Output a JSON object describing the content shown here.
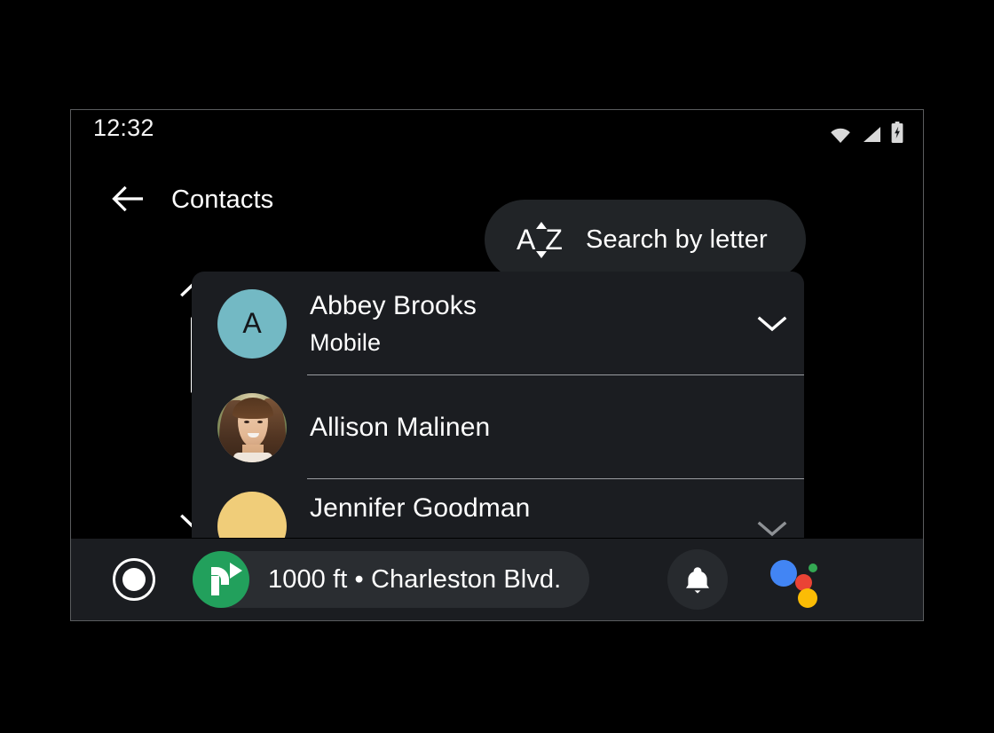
{
  "status_bar": {
    "clock": "12:32",
    "icons": [
      "wifi-icon",
      "cell-signal-icon",
      "battery-charging-icon"
    ]
  },
  "app_bar": {
    "back_icon": "arrow-left-icon",
    "title": "Contacts",
    "search_button": {
      "icon": "az-sort-icon",
      "icon_letters_left": "A",
      "icon_letters_right": "Z",
      "label": "Search by letter"
    }
  },
  "scrollbar": {
    "up_icon": "chevron-up-icon",
    "down_icon": "chevron-down-icon"
  },
  "contacts": [
    {
      "name": "Abbey Brooks",
      "subtitle": "Mobile",
      "avatar_type": "letter",
      "avatar_letter": "A",
      "avatar_color": "#73b9c4",
      "has_chevron": true,
      "chevron_icon": "chevron-down-icon"
    },
    {
      "name": "Allison Malinen",
      "subtitle": "",
      "avatar_type": "photo",
      "avatar_letter": "",
      "avatar_color": "#7e8a5a",
      "has_chevron": false,
      "chevron_icon": ""
    },
    {
      "name": "Jennifer Goodman",
      "subtitle": "",
      "avatar_type": "letter",
      "avatar_letter": "",
      "avatar_color": "#f0cd79",
      "has_chevron": true,
      "chevron_icon": "chevron-down-icon"
    }
  ],
  "nav_bar": {
    "launcher_icon": "app-launcher-icon",
    "turn_icon": "turn-right-icon",
    "distance_text": "1000 ft • Charleston Blvd.",
    "notification_icon": "bell-icon",
    "assistant_icon": "google-assistant-icon"
  },
  "colors": {
    "background": "#000000",
    "card": "#1b1d21",
    "chip": "#2a2d31",
    "search_pill": "#212427",
    "nav_green": "#22a05c",
    "avatar_teal": "#73b9c4",
    "avatar_gold": "#f0cd79",
    "text": "#ffffff",
    "divider": "#9a9da1",
    "assistant_blue": "#4285f4",
    "assistant_red": "#ea4335",
    "assistant_yellow": "#fbbc05",
    "assistant_green": "#34a853"
  }
}
